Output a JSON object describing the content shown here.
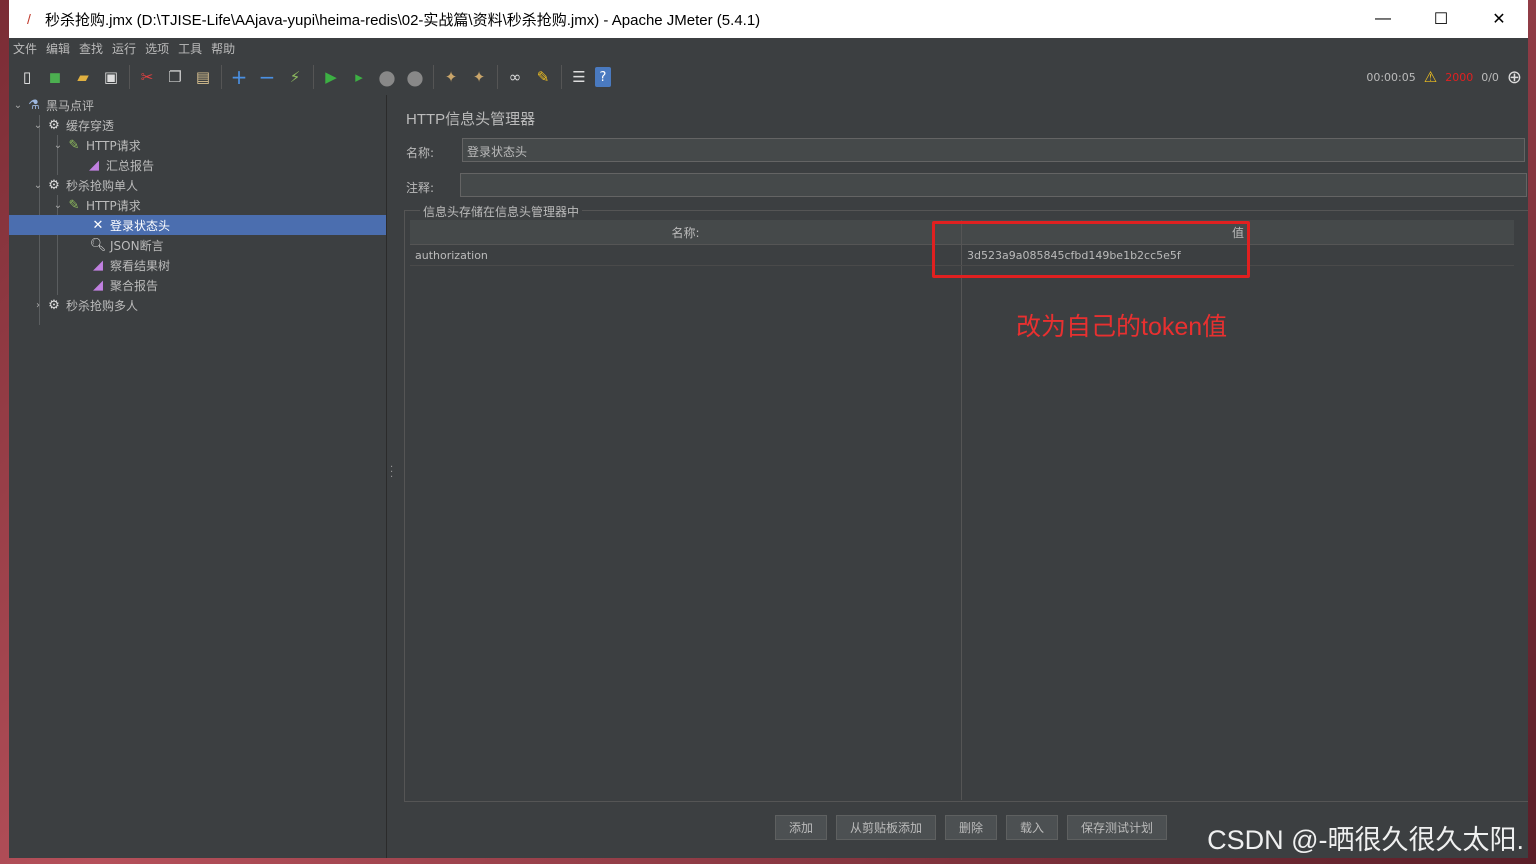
{
  "window": {
    "title": "秒杀抢购.jmx (D:\\TJISE-Life\\AAjava-yupi\\heima-redis\\02-实战篇\\资料\\秒杀抢购.jmx) - Apache JMeter (5.4.1)",
    "minimize_glyph": "—",
    "maximize_glyph": "☐",
    "close_glyph": "✕"
  },
  "menu": [
    "文件",
    "编辑",
    "查找",
    "运行",
    "选项",
    "工具",
    "帮助"
  ],
  "toolbar": {
    "timer": "00:00:05",
    "error_count": "2000",
    "thread_ratio": "0/0",
    "icons": [
      "new-icon",
      "templates-icon",
      "open-icon",
      "save-icon",
      "cut-icon",
      "copy-icon",
      "paste-icon",
      "expand-icon",
      "collapse-icon",
      "toggle-icon",
      "start-icon",
      "start-no-pause-icon",
      "stop-icon",
      "shutdown-icon",
      "clear-icon",
      "clear-all-icon",
      "search-icon",
      "reset-search-icon",
      "function-helper-icon",
      "help-icon"
    ]
  },
  "tree": {
    "root": "黑马点评",
    "group1": "缓存穿透",
    "group1_http": "HTTP请求",
    "group1_report": "汇总报告",
    "group2": "秒杀抢购单人",
    "group2_http": "HTTP请求",
    "header_manager": "登录状态头",
    "json_assertion": "JSON断言",
    "results_tree": "察看结果树",
    "aggregate_report": "聚合报告",
    "group3": "秒杀抢购多人"
  },
  "panel": {
    "title": "HTTP信息头管理器",
    "name_label": "名称:",
    "name_value": "登录状态头",
    "comment_label": "注释:",
    "comment_value": "",
    "group_label": "信息头存储在信息头管理器中",
    "col_name": "名称:",
    "col_value": "值",
    "rows": [
      {
        "name": "authorization",
        "value": "3d523a9a085845cfbd149be1b2cc5e5f"
      }
    ],
    "annotation": "改为自己的token值",
    "buttons": {
      "add": "添加",
      "add_clipboard": "从剪贴板添加",
      "delete": "删除",
      "load": "载入",
      "save_plan": "保存测试计划"
    }
  },
  "watermark": "CSDN @-晒很久很久太阳."
}
